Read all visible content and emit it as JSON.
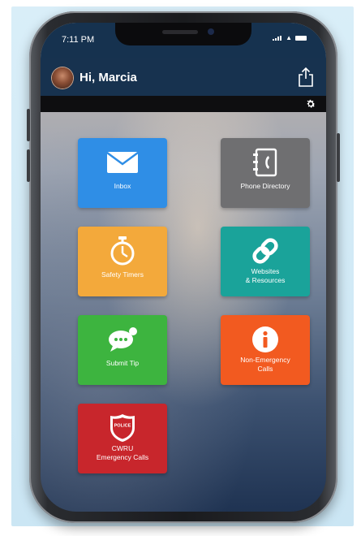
{
  "status_bar": {
    "time": "7:11 PM"
  },
  "header": {
    "greeting": "Hi, Marcia"
  },
  "tiles": [
    {
      "label": "Inbox",
      "icon": "envelope-icon",
      "color": "#2f8ee6"
    },
    {
      "label": "Phone Directory",
      "icon": "phone-book-icon",
      "color": "#6f6f71"
    },
    {
      "label": "Safety Timers",
      "icon": "stopwatch-icon",
      "color": "#f3a93b"
    },
    {
      "label": "Websites\n& Resources",
      "icon": "link-icon",
      "color": "#1aa39a"
    },
    {
      "label": "Submit Tip",
      "icon": "chat-bubble-icon",
      "color": "#3db43f"
    },
    {
      "label": "Non-Emergency\nCalls",
      "icon": "info-icon",
      "color": "#f25a20"
    },
    {
      "label": "CWRU\nEmergency Calls",
      "icon": "police-badge-icon",
      "color": "#c8262c"
    }
  ],
  "badge_text": "POLICE"
}
